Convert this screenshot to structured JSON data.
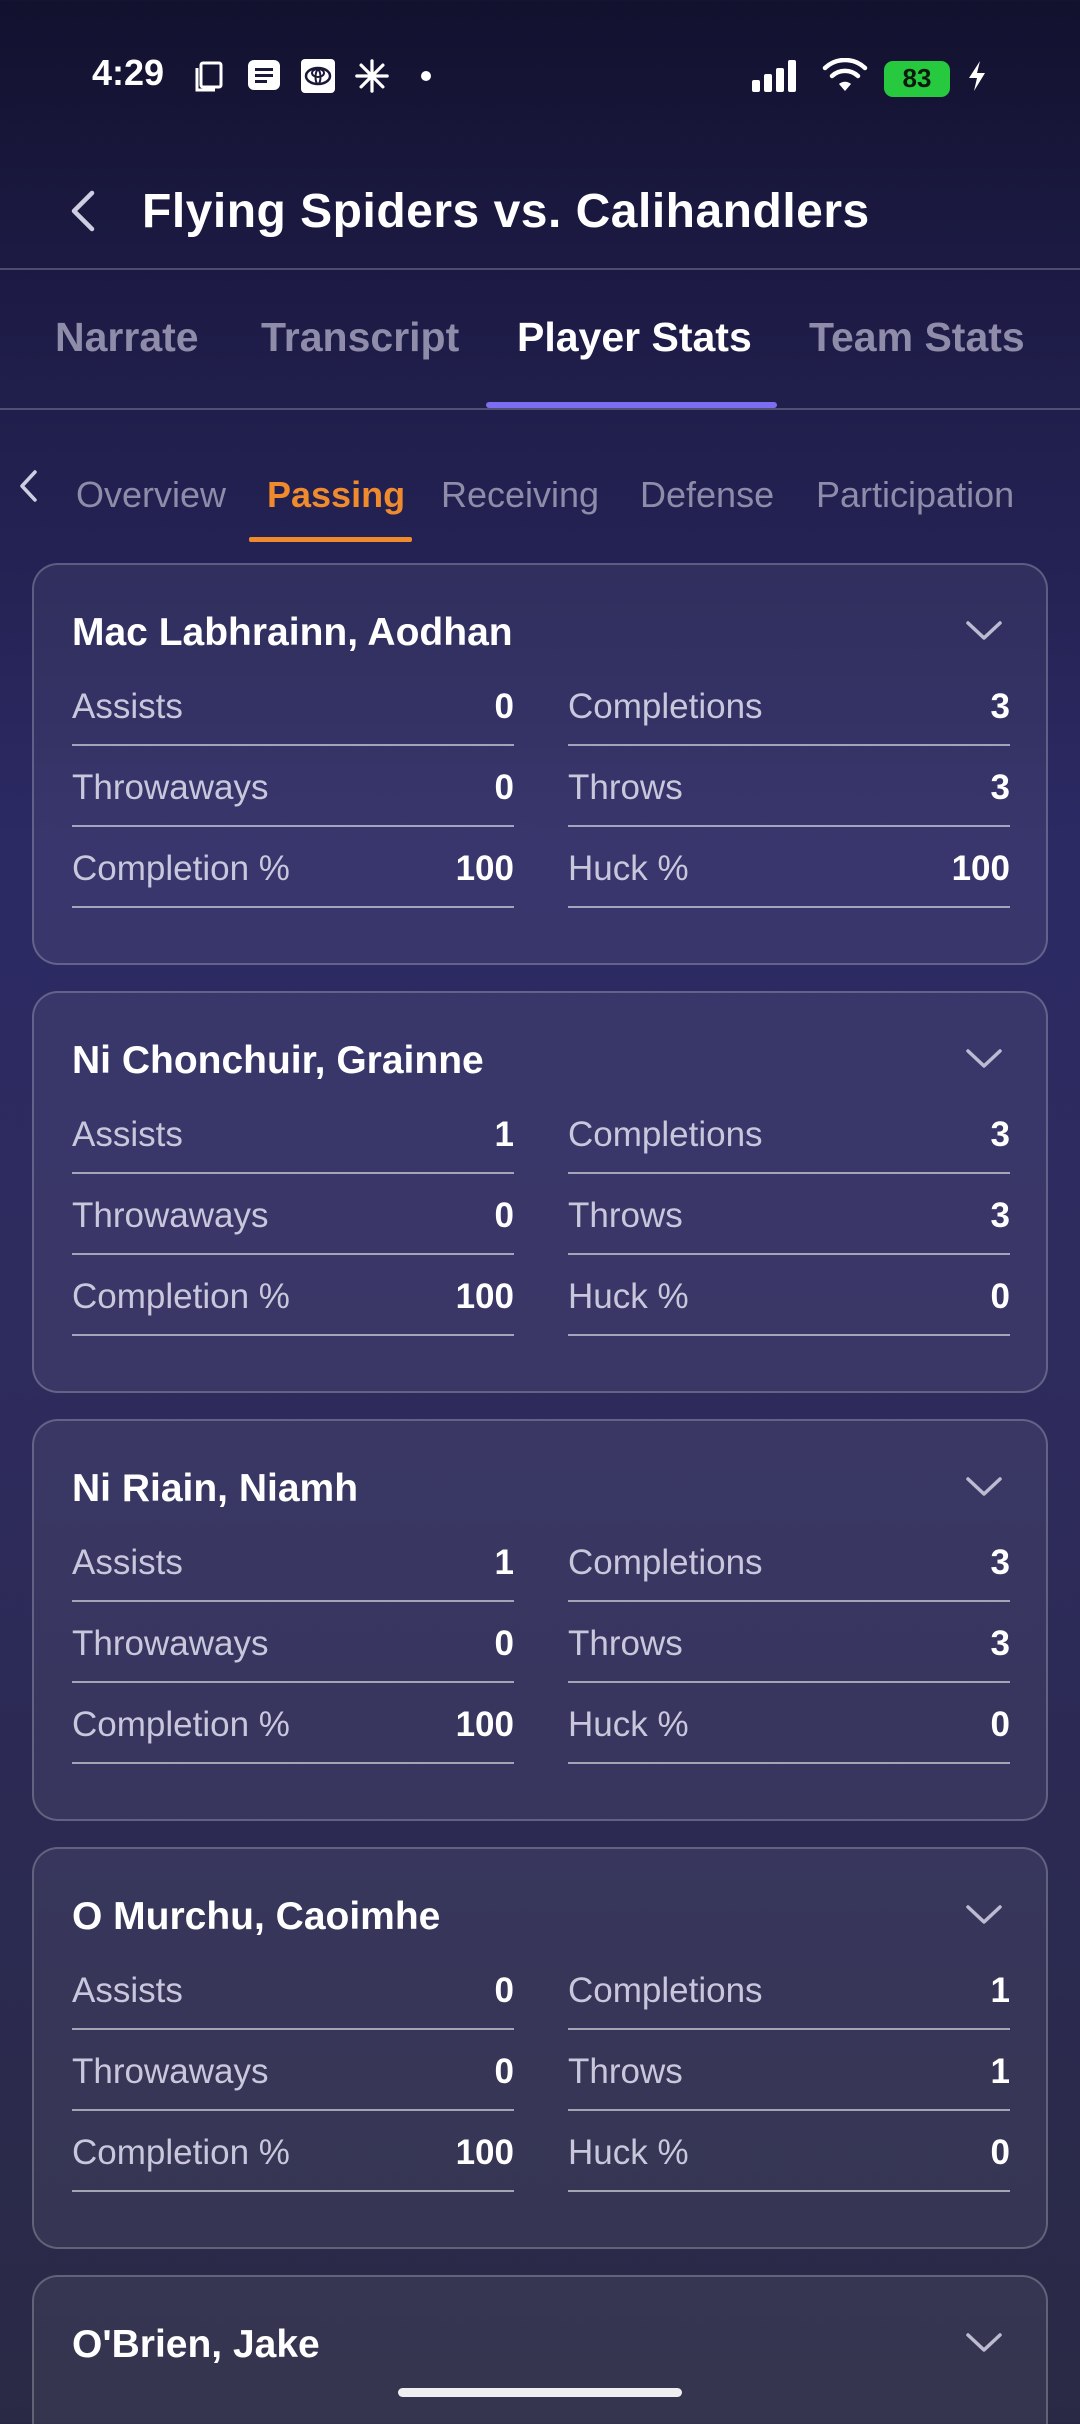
{
  "status_bar": {
    "time": "4:29",
    "battery": "83",
    "icons": [
      "copy-icon",
      "message-icon",
      "toyota-icon",
      "sparkle-icon",
      "dot-icon",
      "signal-icon",
      "wifi-icon",
      "battery-icon",
      "charging-icon"
    ]
  },
  "header": {
    "title": "Flying Spiders vs. Calihandlers"
  },
  "top_tabs": [
    {
      "label": "Narrate",
      "active": false
    },
    {
      "label": "Transcript",
      "active": false
    },
    {
      "label": "Player Stats",
      "active": true
    },
    {
      "label": "Team Stats",
      "active": false
    }
  ],
  "sub_tabs": [
    {
      "label": "Overview",
      "active": false
    },
    {
      "label": "Passing",
      "active": true
    },
    {
      "label": "Receiving",
      "active": false
    },
    {
      "label": "Defense",
      "active": false
    },
    {
      "label": "Participation",
      "active": false
    }
  ],
  "players": [
    {
      "name": "Mac Labhrainn, Aodhan",
      "stats": [
        {
          "label": "Assists",
          "value": "0"
        },
        {
          "label": "Completions",
          "value": "3"
        },
        {
          "label": "Throwaways",
          "value": "0"
        },
        {
          "label": "Throws",
          "value": "3"
        },
        {
          "label": "Completion %",
          "value": "100"
        },
        {
          "label": "Huck %",
          "value": "100"
        }
      ]
    },
    {
      "name": "Ni Chonchuir, Grainne",
      "stats": [
        {
          "label": "Assists",
          "value": "1"
        },
        {
          "label": "Completions",
          "value": "3"
        },
        {
          "label": "Throwaways",
          "value": "0"
        },
        {
          "label": "Throws",
          "value": "3"
        },
        {
          "label": "Completion %",
          "value": "100"
        },
        {
          "label": "Huck %",
          "value": "0"
        }
      ]
    },
    {
      "name": "Ni Riain, Niamh",
      "stats": [
        {
          "label": "Assists",
          "value": "1"
        },
        {
          "label": "Completions",
          "value": "3"
        },
        {
          "label": "Throwaways",
          "value": "0"
        },
        {
          "label": "Throws",
          "value": "3"
        },
        {
          "label": "Completion %",
          "value": "100"
        },
        {
          "label": "Huck %",
          "value": "0"
        }
      ]
    },
    {
      "name": "O Murchu, Caoimhe",
      "stats": [
        {
          "label": "Assists",
          "value": "0"
        },
        {
          "label": "Completions",
          "value": "1"
        },
        {
          "label": "Throwaways",
          "value": "0"
        },
        {
          "label": "Throws",
          "value": "1"
        },
        {
          "label": "Completion %",
          "value": "100"
        },
        {
          "label": "Huck %",
          "value": "0"
        }
      ]
    },
    {
      "name": "O'Brien, Jake",
      "stats": []
    }
  ],
  "colors": {
    "accent_tab": "#7b6ef0",
    "accent_subtab": "#ef8a2d",
    "battery": "#27c93f"
  }
}
